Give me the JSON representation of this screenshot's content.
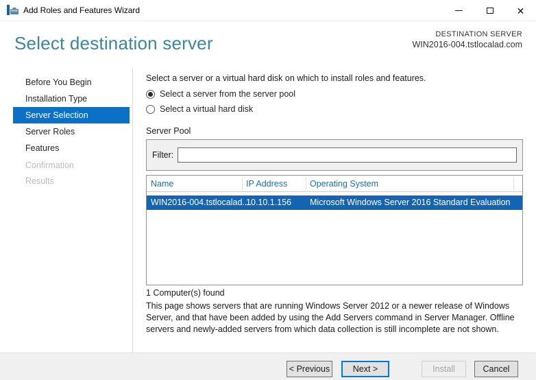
{
  "window": {
    "title": "Add Roles and Features Wizard",
    "controls": {
      "minimize": "minimize",
      "maximize": "maximize",
      "close": "✕"
    }
  },
  "header": {
    "title": "Select destination server",
    "destination_label": "DESTINATION SERVER",
    "destination_server": "WIN2016-004.tstlocalad.com"
  },
  "sidebar": {
    "items": [
      {
        "label": "Before You Begin",
        "state": "normal"
      },
      {
        "label": "Installation Type",
        "state": "normal"
      },
      {
        "label": "Server Selection",
        "state": "selected"
      },
      {
        "label": "Server Roles",
        "state": "normal"
      },
      {
        "label": "Features",
        "state": "normal"
      },
      {
        "label": "Confirmation",
        "state": "disabled"
      },
      {
        "label": "Results",
        "state": "disabled"
      }
    ]
  },
  "main": {
    "intro": "Select a server or a virtual hard disk on which to install roles and features.",
    "radios": [
      {
        "label": "Select a server from the server pool",
        "selected": true
      },
      {
        "label": "Select a virtual hard disk",
        "selected": false
      }
    ],
    "server_pool": {
      "title": "Server Pool",
      "filter_label": "Filter:",
      "filter_value": "",
      "table": {
        "columns": [
          "Name",
          "IP Address",
          "Operating System"
        ],
        "rows": [
          {
            "name": "WIN2016-004.tstlocalad....",
            "ip": "10.10.1.156",
            "os": "Microsoft Windows Server 2016 Standard Evaluation",
            "selected": true
          }
        ]
      },
      "count_text": "1 Computer(s) found"
    },
    "description": "This page shows servers that are running Windows Server 2012 or a newer release of Windows Server, and that have been added by using the Add Servers command in Server Manager. Offline servers and newly-added servers from which data collection is still incomplete are not shown."
  },
  "footer": {
    "buttons": [
      {
        "label": "< Previous",
        "state": "enabled"
      },
      {
        "label": "Next >",
        "state": "default"
      },
      {
        "label": "Install",
        "state": "disabled"
      },
      {
        "label": "Cancel",
        "state": "enabled"
      }
    ]
  },
  "colors": {
    "accent": "#0c71c6",
    "row_selection": "#1464b4",
    "heading": "#3a84a4",
    "table_header_text": "#1271c6"
  }
}
